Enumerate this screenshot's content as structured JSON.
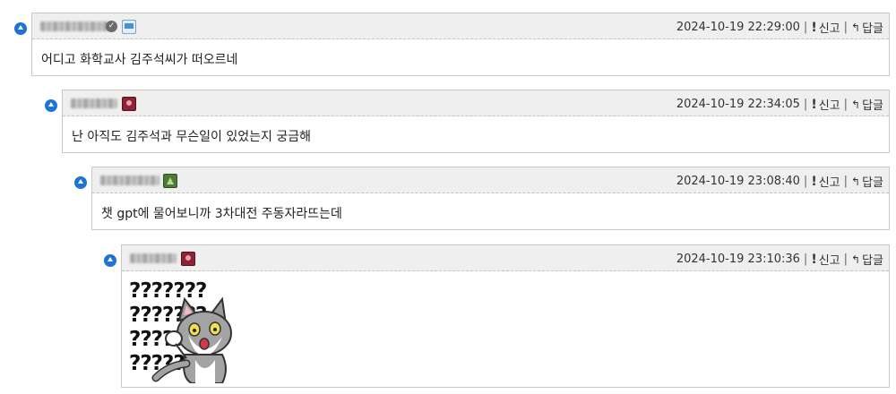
{
  "comments": [
    {
      "timestamp": "2024-10-19 22:29:00",
      "report_label": "신고",
      "reply_label": "답글",
      "text": "어디고 화학교사 김주석씨가 떠오르네"
    },
    {
      "timestamp": "2024-10-19 22:34:05",
      "report_label": "신고",
      "reply_label": "답글",
      "text": "난 아직도 김주석과 무슨일이 있었는지 궁금해"
    },
    {
      "timestamp": "2024-10-19 23:08:40",
      "report_label": "신고",
      "reply_label": "답글",
      "text": "챗 gpt에 물어보니까 3차대전 주동자라뜨는데"
    },
    {
      "timestamp": "2024-10-19 23:10:36",
      "report_label": "신고",
      "reply_label": "답글",
      "sticker_rows": [
        "???????",
        "???????",
        "???????",
        "???????"
      ]
    }
  ],
  "icons": {
    "collapse": "chevron-up-icon",
    "report": "exclamation-icon",
    "reply": "reply-arrow-icon"
  },
  "colors": {
    "collapse_button": "#1e74d4",
    "header_bg": "#efefef",
    "border": "#c8c8c8"
  }
}
